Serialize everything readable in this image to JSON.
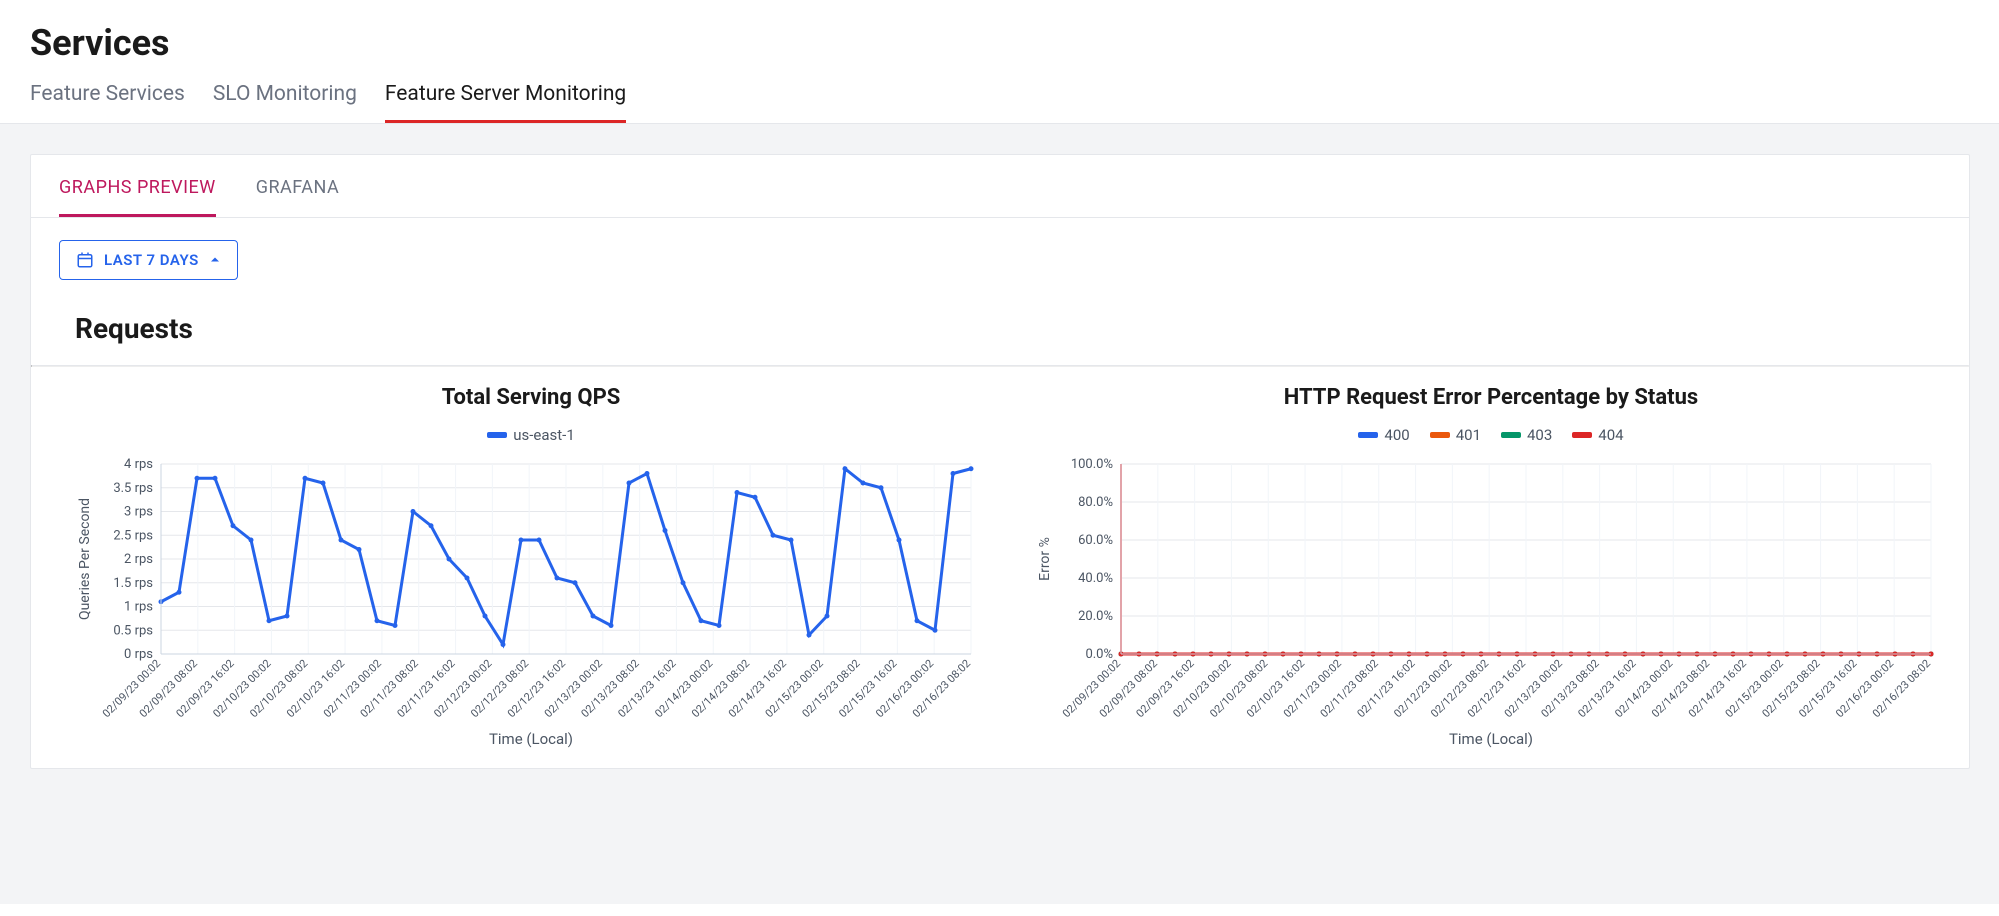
{
  "page_title": "Services",
  "top_tabs": [
    {
      "label": "Feature Services",
      "active": false
    },
    {
      "label": "SLO Monitoring",
      "active": false
    },
    {
      "label": "Feature Server Monitoring",
      "active": true
    }
  ],
  "sub_tabs": [
    {
      "label": "GRAPHS PREVIEW",
      "active": true
    },
    {
      "label": "GRAFANA",
      "active": false
    }
  ],
  "time_selector": {
    "label": "LAST 7 DAYS"
  },
  "section_title": "Requests",
  "chart_data": [
    {
      "type": "line",
      "title": "Total Serving QPS",
      "ylabel": "Queries Per Second",
      "xlabel": "Time (Local)",
      "ylim": [
        0,
        4
      ],
      "y_ticks": [
        "0 rps",
        "0.5 rps",
        "1 rps",
        "1.5 rps",
        "2 rps",
        "2.5 rps",
        "3 rps",
        "3.5 rps",
        "4 rps"
      ],
      "categories": [
        "02/09/23 00:02",
        "02/09/23 08:02",
        "02/09/23 16:02",
        "02/10/23 00:02",
        "02/10/23 08:02",
        "02/10/23 16:02",
        "02/11/23 00:02",
        "02/11/23 08:02",
        "02/11/23 16:02",
        "02/12/23 00:02",
        "02/12/23 08:02",
        "02/12/23 16:02",
        "02/13/23 00:02",
        "02/13/23 08:02",
        "02/13/23 16:02",
        "02/14/23 00:02",
        "02/14/23 08:02",
        "02/14/23 16:02",
        "02/15/23 00:02",
        "02/15/23 08:02",
        "02/15/23 16:02",
        "02/16/23 00:02",
        "02/16/23 08:02"
      ],
      "series": [
        {
          "name": "us-east-1",
          "color": "#2563eb",
          "values": [
            1.1,
            1.3,
            3.7,
            3.7,
            2.7,
            2.4,
            0.7,
            0.8,
            3.7,
            3.6,
            2.4,
            2.2,
            0.7,
            0.6,
            3.0,
            2.7,
            2.0,
            1.6,
            0.8,
            0.2,
            2.4,
            2.4,
            1.6,
            1.5,
            0.8,
            0.6,
            3.6,
            3.8,
            2.6,
            1.5,
            0.7,
            0.6,
            3.4,
            3.3,
            2.5,
            2.4,
            0.4,
            0.8,
            3.9,
            3.6,
            3.5,
            2.4,
            0.7,
            0.5,
            3.8,
            3.9
          ]
        }
      ],
      "x_interval": 2
    },
    {
      "type": "line",
      "title": "HTTP Request Error Percentage by Status",
      "ylabel": "Error %",
      "xlabel": "Time (Local)",
      "ylim": [
        0,
        100
      ],
      "y_ticks": [
        "0.0%",
        "20.0%",
        "40.0%",
        "60.0%",
        "80.0%",
        "100.0%"
      ],
      "categories": [
        "02/09/23 00:02",
        "02/09/23 08:02",
        "02/09/23 16:02",
        "02/10/23 00:02",
        "02/10/23 08:02",
        "02/10/23 16:02",
        "02/11/23 00:02",
        "02/11/23 08:02",
        "02/11/23 16:02",
        "02/12/23 00:02",
        "02/12/23 08:02",
        "02/12/23 16:02",
        "02/13/23 00:02",
        "02/13/23 08:02",
        "02/13/23 16:02",
        "02/14/23 00:02",
        "02/14/23 08:02",
        "02/14/23 16:02",
        "02/15/23 00:02",
        "02/15/23 08:02",
        "02/15/23 16:02",
        "02/16/23 00:02",
        "02/16/23 08:02"
      ],
      "series": [
        {
          "name": "400",
          "color": "#2563eb",
          "values": [
            0,
            0,
            0,
            0,
            0,
            0,
            0,
            0,
            0,
            0,
            0,
            0,
            0,
            0,
            0,
            0,
            0,
            0,
            0,
            0,
            0,
            0,
            0,
            0,
            0,
            0,
            0,
            0,
            0,
            0,
            0,
            0,
            0,
            0,
            0,
            0,
            0,
            0,
            0,
            0,
            0,
            0,
            0,
            0,
            0,
            0
          ]
        },
        {
          "name": "401",
          "color": "#ea580c",
          "values": [
            0,
            0,
            0,
            0,
            0,
            0,
            0,
            0,
            0,
            0,
            0,
            0,
            0,
            0,
            0,
            0,
            0,
            0,
            0,
            0,
            0,
            0,
            0,
            0,
            0,
            0,
            0,
            0,
            0,
            0,
            0,
            0,
            0,
            0,
            0,
            0,
            0,
            0,
            0,
            0,
            0,
            0,
            0,
            0,
            0,
            0
          ]
        },
        {
          "name": "403",
          "color": "#059669",
          "values": [
            0,
            0,
            0,
            0,
            0,
            0,
            0,
            0,
            0,
            0,
            0,
            0,
            0,
            0,
            0,
            0,
            0,
            0,
            0,
            0,
            0,
            0,
            0,
            0,
            0,
            0,
            0,
            0,
            0,
            0,
            0,
            0,
            0,
            0,
            0,
            0,
            0,
            0,
            0,
            0,
            0,
            0,
            0,
            0,
            0,
            0
          ]
        },
        {
          "name": "404",
          "color": "#dc2626",
          "values": [
            0,
            0,
            0,
            0,
            0,
            0,
            0,
            0,
            0,
            0,
            0,
            0,
            0,
            0,
            0,
            0,
            0,
            0,
            0,
            0,
            0,
            0,
            0,
            0,
            0,
            0,
            0,
            0,
            0,
            0,
            0,
            0,
            0,
            0,
            0,
            0,
            0,
            0,
            0,
            0,
            0,
            0,
            0,
            0,
            0,
            0
          ]
        }
      ],
      "highlight_x": true
    }
  ]
}
